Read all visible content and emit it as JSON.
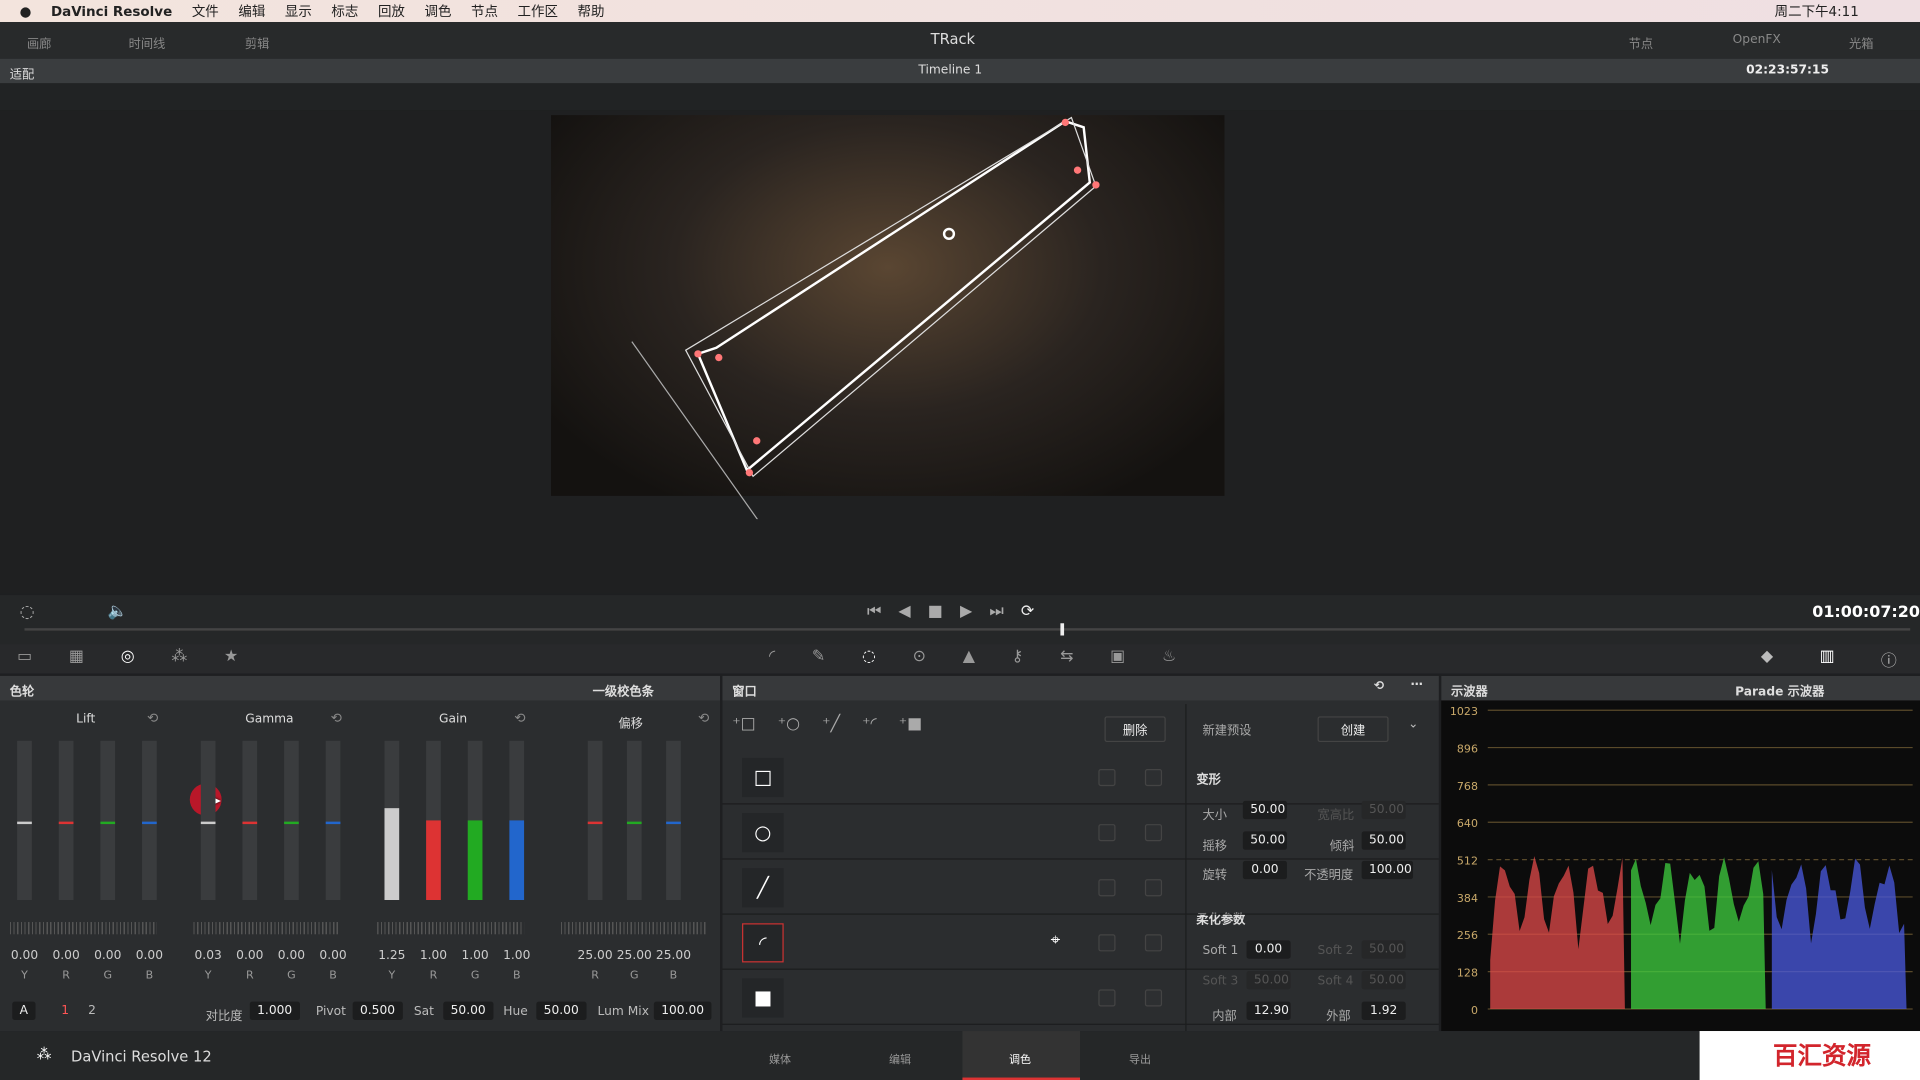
{
  "menubar": {
    "app": "DaVinci Resolve",
    "items": [
      "文件",
      "编辑",
      "显示",
      "标志",
      "回放",
      "调色",
      "节点",
      "工作区",
      "帮助"
    ],
    "clock": "周二下午4:11"
  },
  "topbar": {
    "gallery": "画廊",
    "timeline": "时间线",
    "clips": "剪辑",
    "title": "TRack",
    "nodes": "节点",
    "openfx": "OpenFX",
    "lightbox": "光箱"
  },
  "sub": {
    "fit": "适配",
    "timeline_name": "Timeline 1",
    "timecode": "02:23:57:15"
  },
  "transport": {
    "timecode": "01:00:07:20"
  },
  "wheels": {
    "header": "色轮",
    "mode": "一级校色条",
    "groups": [
      {
        "name": "Lift",
        "labels": [
          "Y",
          "R",
          "G",
          "B"
        ],
        "values": [
          "0.00",
          "0.00",
          "0.00",
          "0.00"
        ]
      },
      {
        "name": "Gamma",
        "labels": [
          "Y",
          "R",
          "G",
          "B"
        ],
        "values": [
          "0.03",
          "0.00",
          "0.00",
          "0.00"
        ]
      },
      {
        "name": "Gain",
        "labels": [
          "Y",
          "R",
          "G",
          "B"
        ],
        "values": [
          "1.25",
          "1.00",
          "1.00",
          "1.00"
        ]
      },
      {
        "name": "偏移",
        "labels": [
          "R",
          "G",
          "B"
        ],
        "values": [
          "25.00",
          "25.00",
          "25.00"
        ]
      }
    ],
    "footer": {
      "a": "A",
      "p1": "1",
      "p2": "2",
      "contrast_label": "对比度",
      "contrast": "1.000",
      "pivot_label": "Pivot",
      "pivot": "0.500",
      "sat_label": "Sat",
      "sat": "50.00",
      "hue_label": "Hue",
      "hue": "50.00",
      "lummix_label": "Lum Mix",
      "lummix": "100.00"
    }
  },
  "window": {
    "header": "窗口",
    "delete": "删除",
    "new_preset": "新建预设",
    "create": "创建",
    "transform": "变形",
    "size_label": "大小",
    "size": "50.00",
    "aspect_label": "宽高比",
    "aspect": "50.00",
    "pan_label": "摇移",
    "pan": "50.00",
    "tilt_label": "倾斜",
    "tilt": "50.00",
    "rotate_label": "旋转",
    "rotate": "0.00",
    "opacity_label": "不透明度",
    "opacity": "100.00",
    "softness": "柔化参数",
    "soft1_label": "Soft 1",
    "soft1": "0.00",
    "soft2_label": "Soft 2",
    "soft2": "50.00",
    "soft3_label": "Soft 3",
    "soft3": "50.00",
    "soft4_label": "Soft 4",
    "soft4": "50.00",
    "inside_label": "内部",
    "inside": "12.90",
    "outside_label": "外部",
    "outside": "1.92",
    "shapes": [
      "□",
      "○",
      "╱",
      "◜",
      "■"
    ]
  },
  "scope": {
    "header": "示波器",
    "mode": "Parade 示波器",
    "ticks": [
      "1023",
      "896",
      "768",
      "640",
      "512",
      "384",
      "256",
      "128",
      "0"
    ]
  },
  "bottom": {
    "app": "DaVinci Resolve 12",
    "pages": [
      "媒体",
      "编辑",
      "调色",
      "导出"
    ],
    "watermark": "百汇资源"
  }
}
